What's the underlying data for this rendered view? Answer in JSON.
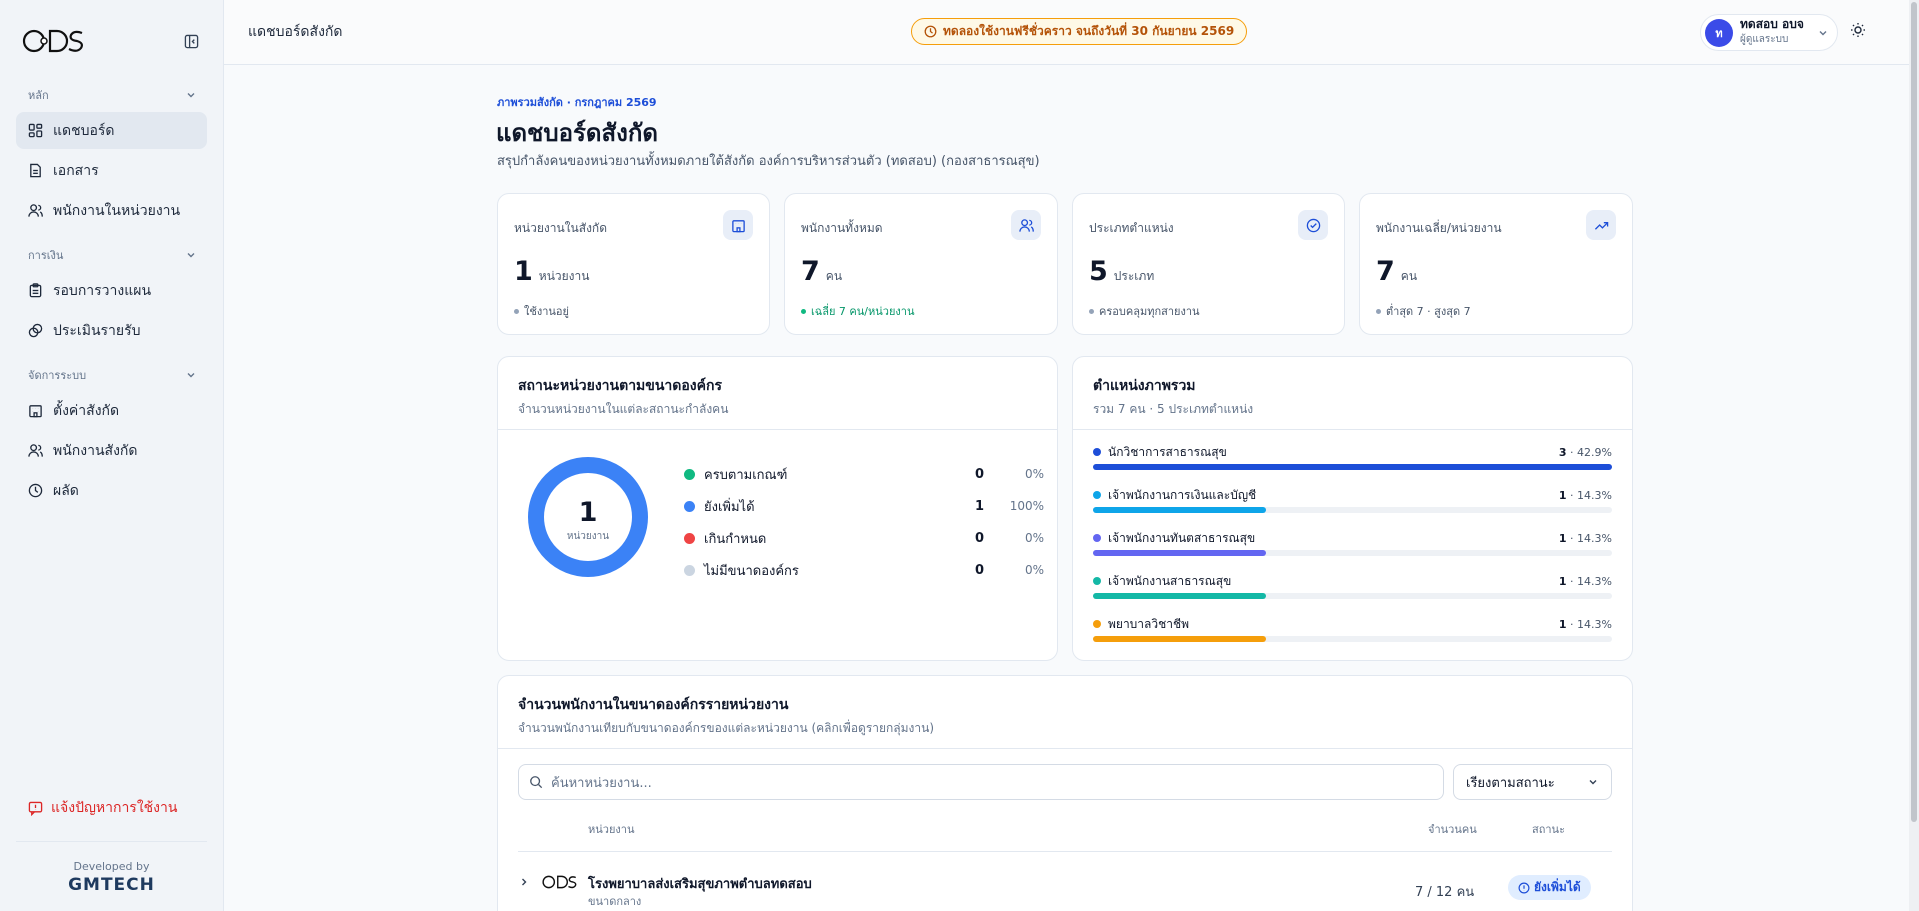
{
  "sidebar": {
    "sections": [
      {
        "title": "หลัก",
        "items": [
          {
            "label": "แดชบอร์ด",
            "icon": "grid-icon"
          },
          {
            "label": "เอกสาร",
            "icon": "document-icon"
          },
          {
            "label": "พนักงานในหน่วยงาน",
            "icon": "users-icon"
          }
        ]
      },
      {
        "title": "การเงิน",
        "items": [
          {
            "label": "รอบการวางแผน",
            "icon": "clipboard-icon"
          },
          {
            "label": "ประเมินรายรับ",
            "icon": "coins-icon"
          }
        ]
      },
      {
        "title": "จัดการระบบ",
        "items": [
          {
            "label": "ตั้งค่าสังกัด",
            "icon": "building-icon"
          },
          {
            "label": "พนักงานสังกัด",
            "icon": "users-icon"
          },
          {
            "label": "ผลัด",
            "icon": "clock-icon"
          }
        ]
      }
    ],
    "report_label": "แจ้งปัญหาการใช้งาน",
    "developed_by": "Developed by",
    "brand": "GMTECH"
  },
  "topbar": {
    "title": "แดชบอร์ดสังกัด",
    "trial_notice": "ทดลองใช้งานฟรีชั่วคราว จนถึงวันที่ 30 กันยายน 2569",
    "user": {
      "initial": "ท",
      "name": "ทดสอบ อบจ",
      "role": "ผู้ดูแลระบบ"
    }
  },
  "header": {
    "eyebrow": "ภาพรวมสังกัด · กรกฎาคม 2569",
    "title": "แดชบอร์ดสังกัด",
    "subtitle": "สรุปกำลังคนของหน่วยงานทั้งหมดภายใต้สังกัด องค์การบริหารส่วนตัว (ทดสอบ) (กองสาธารณสุข)"
  },
  "stats": [
    {
      "label": "หน่วยงานในสังกัด",
      "value": "1",
      "unit": "หน่วยงาน",
      "note": "ใช้งานอยู่",
      "icon": "building-icon"
    },
    {
      "label": "พนักงานทั้งหมด",
      "value": "7",
      "unit": "คน",
      "note": "เฉลี่ย 7 คน/หน่วยงาน",
      "icon": "users-icon"
    },
    {
      "label": "ประเภทตำแหน่ง",
      "value": "5",
      "unit": "ประเภท",
      "note": "ครอบคลุมทุกสายงาน",
      "icon": "check-circle-icon"
    },
    {
      "label": "พนักงานเฉลี่ย/หน่วยงาน",
      "value": "7",
      "unit": "คน",
      "note": "ต่ำสุด 7 · สูงสุด 7",
      "icon": "trending-up-icon"
    }
  ],
  "status_card": {
    "title": "สถานะหน่วยงานตามขนาดองค์กร",
    "subtitle": "จำนวนหน่วยงานในแต่ละสถานะกำลังคน",
    "donut_value": "1",
    "donut_label": "หน่วยงาน",
    "items": [
      {
        "label": "ครบตามเกณฑ์",
        "count": "0",
        "pct": "0%",
        "color": "#10b981"
      },
      {
        "label": "ยังเพิ่มได้",
        "count": "1",
        "pct": "100%",
        "color": "#3b82f6"
      },
      {
        "label": "เกินกำหนด",
        "count": "0",
        "pct": "0%",
        "color": "#ef4444"
      },
      {
        "label": "ไม่มีขนาดองค์กร",
        "count": "0",
        "pct": "0%",
        "color": "#cbd5e1"
      }
    ]
  },
  "positions_card": {
    "title": "ตำแหน่งภาพรวม",
    "subtitle": "รวม 7 คน · 5 ประเภทตำแหน่ง",
    "items": [
      {
        "label": "นักวิชาการสาธารณสุข",
        "count": "3",
        "pct": "42.9%",
        "fraction": 1.0,
        "color": "#1d4ed8"
      },
      {
        "label": "เจ้าพนักงานการเงินและบัญชี",
        "count": "1",
        "pct": "14.3%",
        "fraction": 0.333,
        "color": "#0ea5e9"
      },
      {
        "label": "เจ้าพนักงานทันตสาธารณสุข",
        "count": "1",
        "pct": "14.3%",
        "fraction": 0.333,
        "color": "#6366f1"
      },
      {
        "label": "เจ้าพนักงานสาธารณสุข",
        "count": "1",
        "pct": "14.3%",
        "fraction": 0.333,
        "color": "#14b8a6"
      },
      {
        "label": "พยาบาลวิชาชีพ",
        "count": "1",
        "pct": "14.3%",
        "fraction": 0.333,
        "color": "#f59e0b"
      }
    ]
  },
  "units_card": {
    "title": "จำนวนพนักงานในขนาดองค์กรรายหน่วยงาน",
    "subtitle": "จำนวนพนักงานเทียบกับขนาดองค์กรของแต่ละหน่วยงาน (คลิกเพื่อดูรายกลุ่มงาน)",
    "search_placeholder": "ค้นหาหน่วยงาน...",
    "sort_label": "เรียงตามสถานะ",
    "columns": {
      "unit": "หน่วยงาน",
      "count": "จำนวนคน",
      "status": "สถานะ"
    },
    "rows": [
      {
        "name": "โรงพยาบาลส่งเสริมสุขภาพตำบลทดสอบ",
        "size": "ขนาดกลาง",
        "count": "7 / 12 คน",
        "status": "ยังเพิ่มได้"
      }
    ]
  }
}
